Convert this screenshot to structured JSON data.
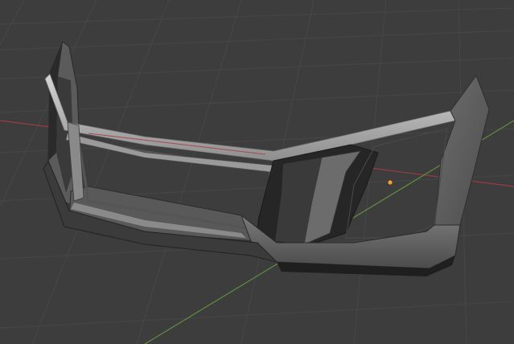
{
  "viewport": {
    "view": "perspective",
    "background_color": "#3d3d3d",
    "grid_color": "#4a4a4a",
    "x_axis_color": "#9a3c42",
    "y_axis_color": "#5f8f3e",
    "origin_color": "#f0a040"
  },
  "object": {
    "name_icon": "mesh-object",
    "material_colors": {
      "light": "#bdbdbd",
      "mid": "#808080",
      "dark": "#4a4a4a",
      "shadow": "#1b1b1b"
    }
  }
}
